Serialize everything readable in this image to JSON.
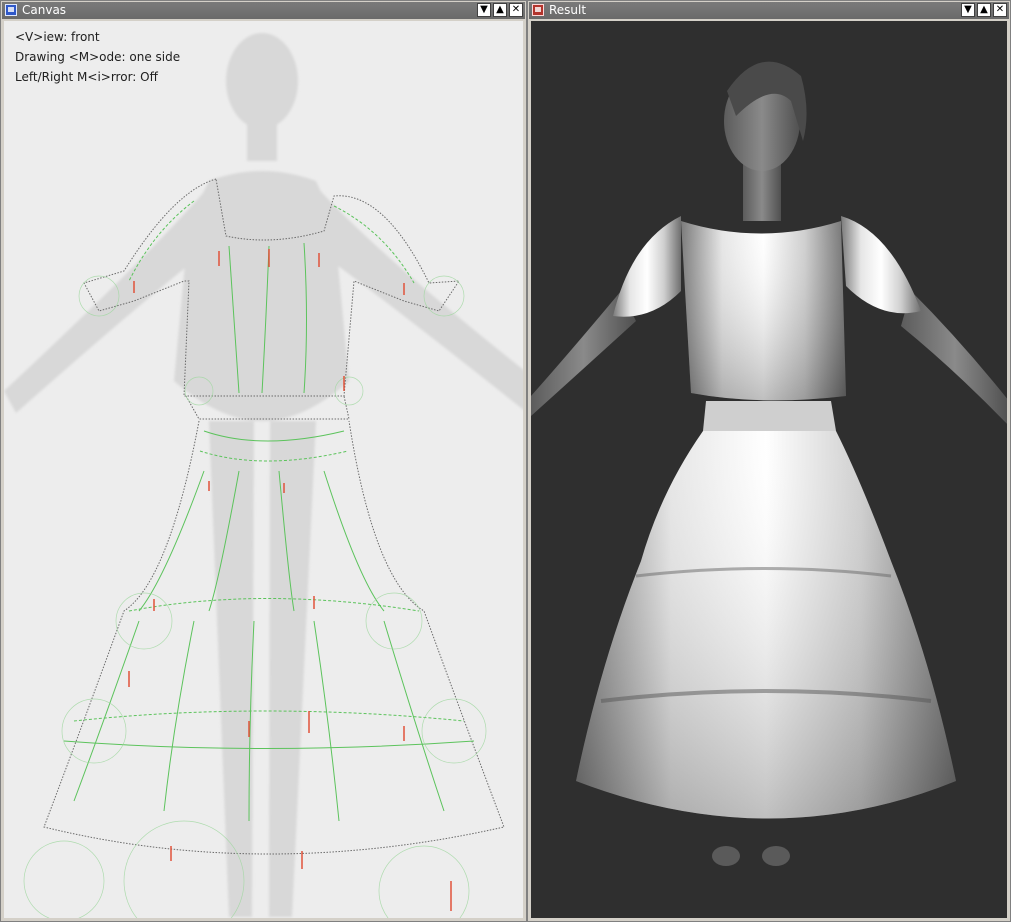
{
  "windows": {
    "canvas": {
      "title": "Canvas",
      "hud": {
        "view": "<V>iew: front",
        "mode": "Drawing <M>ode: one side",
        "mirror": "Left/Right M<i>rror: Off"
      }
    },
    "result": {
      "title": "Result"
    }
  },
  "titlebar_buttons": {
    "minimize": "▼",
    "maximize": "▲",
    "close": "✕"
  },
  "colors": {
    "titlebar": "#6e6e6e",
    "canvas_bg": "#ededed",
    "result_bg": "#2f2f2f",
    "guide_green": "#5cc35c",
    "outline_gray": "#6a6a6a",
    "marker_red": "#e0523a"
  }
}
